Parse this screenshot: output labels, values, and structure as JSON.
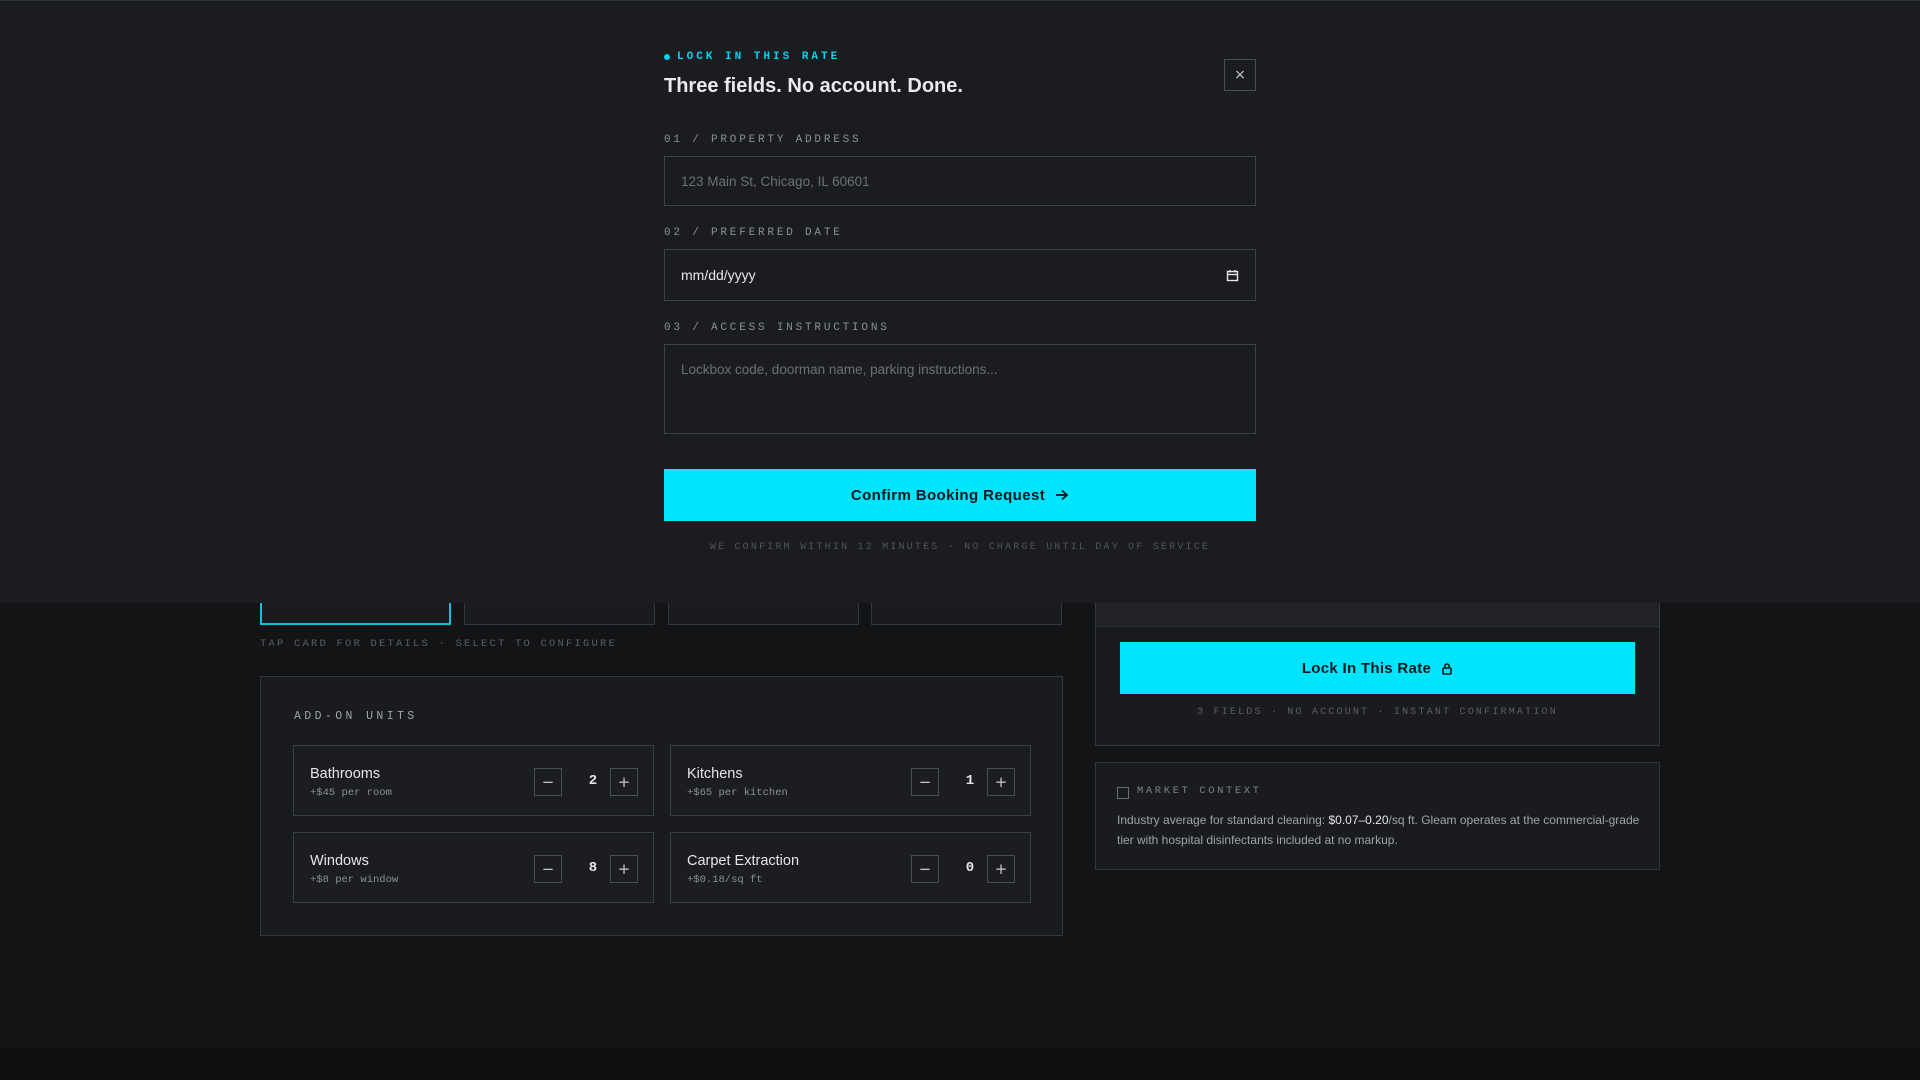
{
  "modal": {
    "eyebrow": "LOCK IN THIS RATE",
    "title": "Three fields. No account. Done.",
    "close_label": "×",
    "fields": {
      "address": {
        "label": "01 / PROPERTY ADDRESS",
        "placeholder": "123 Main St, Chicago, IL 60601",
        "value": ""
      },
      "date": {
        "label": "02 / PREFERRED DATE",
        "placeholder": "mm/dd/yyyy",
        "value": ""
      },
      "access": {
        "label": "03 / ACCESS INSTRUCTIONS",
        "placeholder": "Lockbox code, doorman name, parking instructions...",
        "value": ""
      }
    },
    "confirm_label": "Confirm Booking Request",
    "confirm_hint": "WE CONFIRM WITHIN 12 MINUTES · NO CHARGE UNTIL DAY OF SERVICE"
  },
  "services": {
    "hint": "TAP CARD FOR DETAILS · SELECT TO CONFIGURE"
  },
  "addons": {
    "title": "ADD-ON UNITS",
    "units": [
      {
        "name": "Bathrooms",
        "price": "+$45 per room",
        "count": "2"
      },
      {
        "name": "Kitchens",
        "price": "+$65 per kitchen",
        "count": "1"
      },
      {
        "name": "Windows",
        "price": "+$8 per window",
        "count": "8"
      },
      {
        "name": "Carpet Extraction",
        "price": "+$0.18/sq ft",
        "count": "0"
      }
    ],
    "decrement_label": "−",
    "increment_label": "+"
  },
  "rate": {
    "button_label": "Lock In This Rate",
    "hint": "3 FIELDS · NO ACCOUNT · INSTANT CONFIRMATION"
  },
  "market": {
    "title": "MARKET CONTEXT",
    "text_before": "Industry average for standard cleaning: ",
    "highlight": "$0.07–0.20",
    "text_after": "/sq ft. Gleam operates at the commercial-grade tier with hospital disinfectants included at no markup."
  },
  "colors": {
    "accent": "#00e5ff",
    "background": "#131416",
    "surface": "#1b1c1f"
  },
  "icons": {
    "confirm": "arrow-right-icon",
    "lock": "lock-icon",
    "date": "calendar-icon",
    "close": "close-icon"
  }
}
